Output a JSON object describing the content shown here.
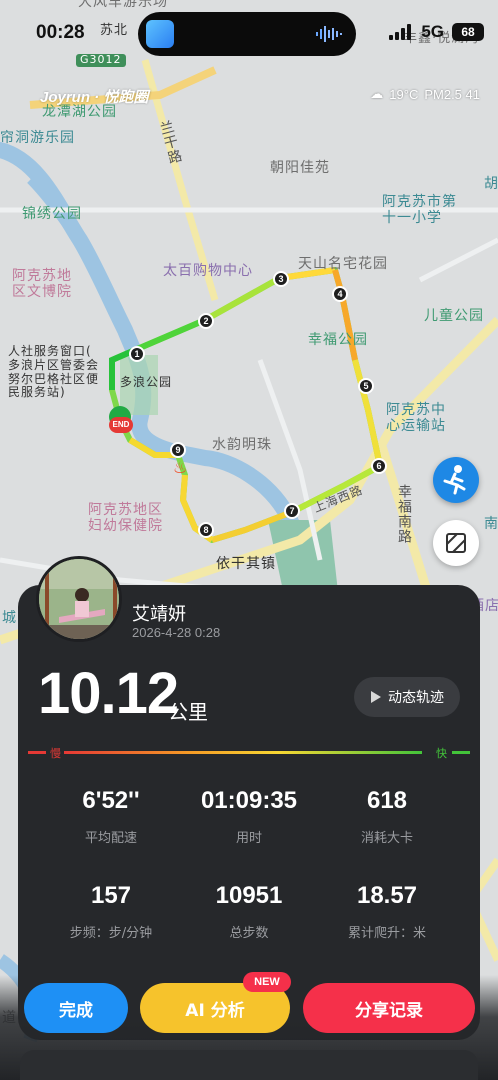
{
  "status": {
    "time": "00:28",
    "network": "5G",
    "battery": "68"
  },
  "brand": "Joyrun · 悦跑圈",
  "weather": {
    "temperature": "19°C",
    "air": "PM2.5 41"
  },
  "map": {
    "labels": {
      "fun_world": "大风车游乐场",
      "su_bei": "苏北",
      "road_g3012": "G3012",
      "longtan_park": "龙潭湖公园",
      "dong_park": "帘洞游乐园",
      "lan_road": "兰干路",
      "chaoyang": "朝阳佳苑",
      "akesu_school": "阿克苏市第\n十一小学",
      "hu": "胡",
      "jinxiu_park": "锦绣公园",
      "taibai": "太百购物中心",
      "mingzhai": "天山名宅花园",
      "culture_museum": "阿克苏地\n区文博院",
      "xingfu_park": "幸福公园",
      "children_park": "儿童公园",
      "service_station": "人社服务窗口(\n多浪片区管委会\n努尔巴格社区便\n民服务站)",
      "duolang_park": "多浪公园",
      "shuiyun": "水韵明珠",
      "transport": "阿克苏中\n心运输站",
      "maternal": "阿克苏地区\n妇幼保健院",
      "xingfu_south": "幸福南路",
      "shanghai_road": "上海西路",
      "yiganqi": "依干其镇",
      "cheng": "城",
      "nan": "南",
      "jiudian": "酒店",
      "dao": "道",
      "fengxin": "丰鑫·悦澜湾"
    },
    "markers": [
      "1",
      "2",
      "3",
      "4",
      "5",
      "6",
      "7",
      "8",
      "9"
    ],
    "end_label": "END"
  },
  "run": {
    "user_name": "艾靖妍",
    "datetime": "2026-4-28 0:28",
    "distance": "10.12",
    "distance_unit": "公里",
    "replay_label": "动态轨迹",
    "pace_slow": "慢",
    "pace_fast": "快",
    "stats": [
      {
        "value": "6'52''",
        "label": "平均配速"
      },
      {
        "value": "01:09:35",
        "label": "用时"
      },
      {
        "value": "618",
        "label": "消耗大卡"
      },
      {
        "value": "157",
        "label": "步频：步/分钟"
      },
      {
        "value": "10951",
        "label": "总步数"
      },
      {
        "value": "18.57",
        "label": "累计爬升：米"
      }
    ]
  },
  "actions": {
    "finish": "完成",
    "ai": "AI 分析",
    "ai_badge": "NEW",
    "share": "分享记录"
  },
  "colors": {
    "slow": "#e53935",
    "fast": "#43c43a",
    "finish": "#1e90f5",
    "ai": "#f6c32c",
    "share": "#f5304a"
  }
}
